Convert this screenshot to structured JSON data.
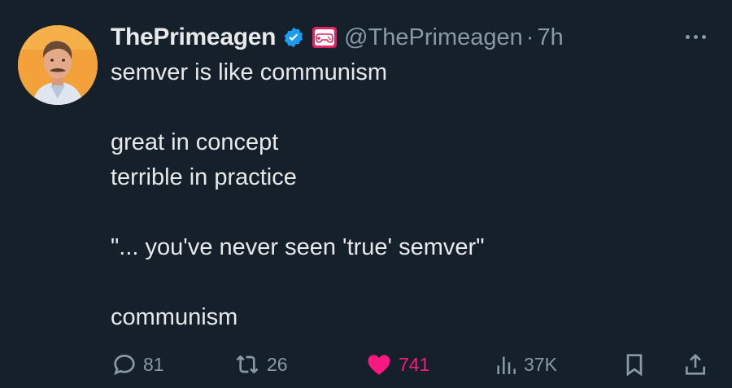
{
  "author": {
    "name": "ThePrimeagen",
    "handle": "@ThePrimeagen",
    "separator": "·",
    "time": "7h"
  },
  "tweet_lines": [
    "semver is like communism",
    "",
    "great in concept",
    "terrible in practice",
    "",
    "\"... you've never seen 'true' semver\"",
    "",
    "communism"
  ],
  "actions": {
    "replies": "81",
    "retweets": "26",
    "likes": "741",
    "views": "37K"
  },
  "colors": {
    "background": "#15202b",
    "text": "#e7e9ea",
    "muted": "#8b98a5",
    "verified": "#1d9bf0",
    "like": "#f91880",
    "affiliation_badge": "#e0245e"
  },
  "icons": {
    "verified": "verified-badge-icon",
    "affiliation": "gamepad-icon",
    "more": "more-dots-icon",
    "reply": "reply-bubble-icon",
    "retweet": "retweet-icon",
    "like": "heart-filled-icon",
    "views": "views-bars-icon",
    "bookmark": "bookmark-icon",
    "share": "share-icon"
  }
}
